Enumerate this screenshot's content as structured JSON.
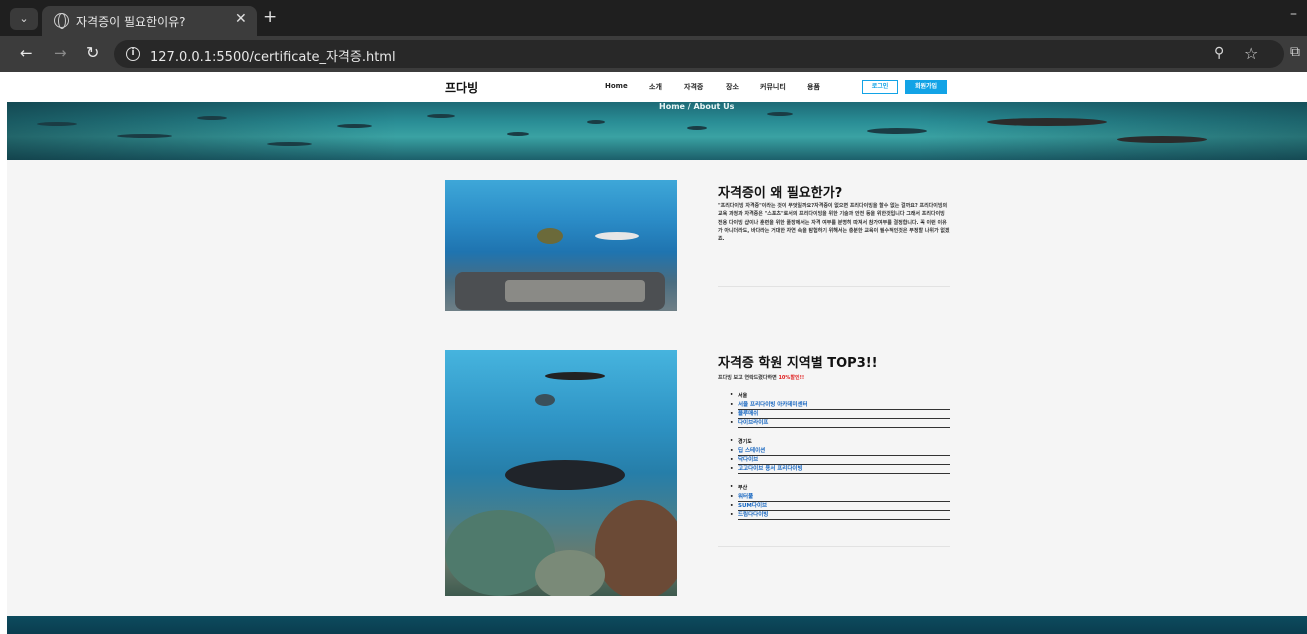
{
  "browser": {
    "tab_title": "자격증이 필요한이유?",
    "url": "127.0.0.1:5500/certificate_자격증.html"
  },
  "header": {
    "logo": "프다빙",
    "nav": [
      "Home",
      "소개",
      "자격증",
      "장소",
      "커뮤니티",
      "용품"
    ],
    "login_label": "로그인",
    "join_label": "회원가입"
  },
  "hero": {
    "breadcrumb": "Home / About Us"
  },
  "section1": {
    "title": "자격증이 왜 필요한가?",
    "paragraph": "\"프리다이빙 자격증\"이라는 것이 무엇일까요?자격증이 없으면 프리다이빙을 할수 없는 걸까요? 프리다이빙의 교육 과정과 자격증은 \"스포츠\"로서의 프리다이빙을 위한 기술과 안전 등을 위한것입니다 그래서 프리다이빙 전용 다이빙 샵이나 훈련을 위한 풀장에서는 자격 여부를 분명히 따져서 참가여부를 결정합니다. 꼭 이런 이유가 아니더라도, 바다라는 거대한 자연 속을 탐험하기 위해서는 충분한 교육이 필수적인것은 부정할 나위가 없겠죠."
  },
  "section2": {
    "title": "자격증 학원 지역별 TOP3!!",
    "subtitle_prefix": "프다빙 보고 연락드렸다하면 ",
    "subtitle_highlight": "10%할인!!",
    "regions": [
      {
        "name": "서울",
        "links": [
          "서울 프리다이빙 아카데미센터",
          "블루매쉬",
          "다이브라이프"
        ]
      },
      {
        "name": "경기도",
        "links": [
          "딥 스테이션",
          "닥다이브",
          "고고다이브 용서 프리다이빙"
        ]
      },
      {
        "name": "부산",
        "links": [
          "워터풀",
          "SUM다이브",
          "드림다다이빙"
        ]
      }
    ]
  },
  "colors": {
    "accent": "#12a3e6",
    "highlight_red": "#e02020",
    "link_blue": "#1565c0"
  }
}
